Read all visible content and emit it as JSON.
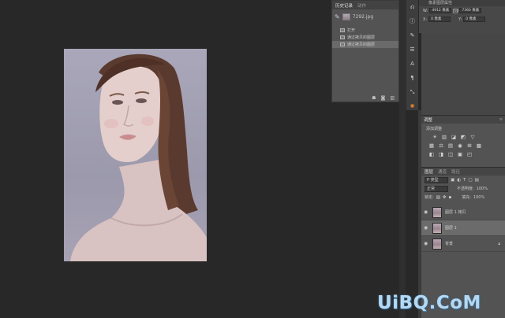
{
  "history": {
    "tabs": [
      "历史记录",
      "动作"
    ],
    "snapshot_name": "7292.jpg",
    "items": [
      "打开",
      "通过拷贝的图层",
      "通过拷贝的图层"
    ],
    "selected_index": 2,
    "footer_icons": [
      "new-snapshot-icon",
      "camera-icon",
      "trash-icon"
    ]
  },
  "properties": {
    "header": "像素图层属性",
    "w_label": "W:",
    "w_value": "4912 像素",
    "go_label": "GO",
    "h_value": "7360 像素",
    "x_label": "X:",
    "x_value": "0 像素",
    "y_label": "Y:",
    "y_value": "0 像素"
  },
  "adjustments": {
    "tab": "调整",
    "title": "添加调整",
    "rows": [
      [
        "☀",
        "▥",
        "◪",
        "◩",
        "▽"
      ],
      [
        "▦",
        "⚖",
        "▤",
        "◉",
        "⊞",
        "▩"
      ],
      [
        "◧",
        "◨",
        "◫",
        "▣",
        "◰"
      ]
    ]
  },
  "layers": {
    "tabs": [
      "图层",
      "通道",
      "路径"
    ],
    "kind_filter": "P 类型",
    "blend_mode": "正常",
    "opacity_label": "不透明度:",
    "opacity_value": "100%",
    "lock_label": "锁定:",
    "fill_label": "填充:",
    "fill_value": "100%",
    "items": [
      {
        "name": "图层 1 拷贝",
        "selected": false
      },
      {
        "name": "图层 1",
        "selected": true
      },
      {
        "name": "背景",
        "selected": false,
        "locked": true
      }
    ]
  },
  "watermark": "UiBQ.CoM",
  "colors": {
    "canvas_bg": "#282828",
    "panel_bg": "#535353",
    "accent_orange": "#e5892e",
    "watermark": "#b5d8f2"
  }
}
